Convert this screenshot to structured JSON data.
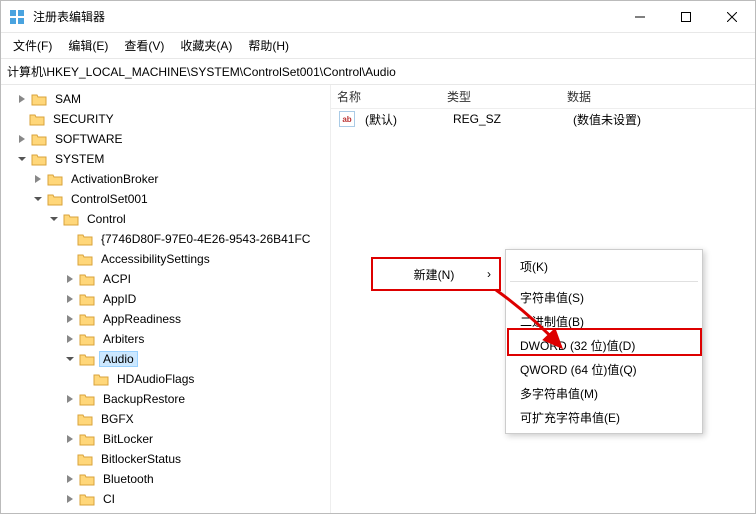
{
  "window": {
    "title": "注册表编辑器"
  },
  "menu": {
    "file": "文件(F)",
    "edit": "编辑(E)",
    "view": "查看(V)",
    "favorites": "收藏夹(A)",
    "help": "帮助(H)"
  },
  "address": "计算机\\HKEY_LOCAL_MACHINE\\SYSTEM\\ControlSet001\\Control\\Audio",
  "tree": {
    "sam": "SAM",
    "security": "SECURITY",
    "software": "SOFTWARE",
    "system": "SYSTEM",
    "activationBroker": "ActivationBroker",
    "controlSet001": "ControlSet001",
    "control": "Control",
    "guidKey": "{7746D80F-97E0-4E26-9543-26B41FC",
    "accessibilitySettings": "AccessibilitySettings",
    "acpi": "ACPI",
    "appId": "AppID",
    "appReadiness": "AppReadiness",
    "arbiters": "Arbiters",
    "audio": "Audio",
    "hdAudioFlags": "HDAudioFlags",
    "backupRestore": "BackupRestore",
    "bgfx": "BGFX",
    "bitLocker": "BitLocker",
    "bitlockerStatus": "BitlockerStatus",
    "bluetooth": "Bluetooth",
    "ci": "CI"
  },
  "list": {
    "headers": {
      "name": "名称",
      "type": "类型",
      "data": "数据"
    },
    "rows": [
      {
        "icon": "ab",
        "name": "(默认)",
        "type": "REG_SZ",
        "data": "(数值未设置)"
      }
    ]
  },
  "contextMenu": {
    "new": "新建(N)",
    "items": {
      "key": "项(K)",
      "string": "字符串值(S)",
      "binary": "二进制值(B)",
      "dword": "DWORD (32 位)值(D)",
      "qword": "QWORD (64 位)值(Q)",
      "multiString": "多字符串值(M)",
      "expandString": "可扩充字符串值(E)"
    }
  },
  "colors": {
    "highlight": "#d00",
    "selection": "#cce8ff",
    "folderFill": "#ffd77a",
    "folderStroke": "#d9a33b"
  }
}
